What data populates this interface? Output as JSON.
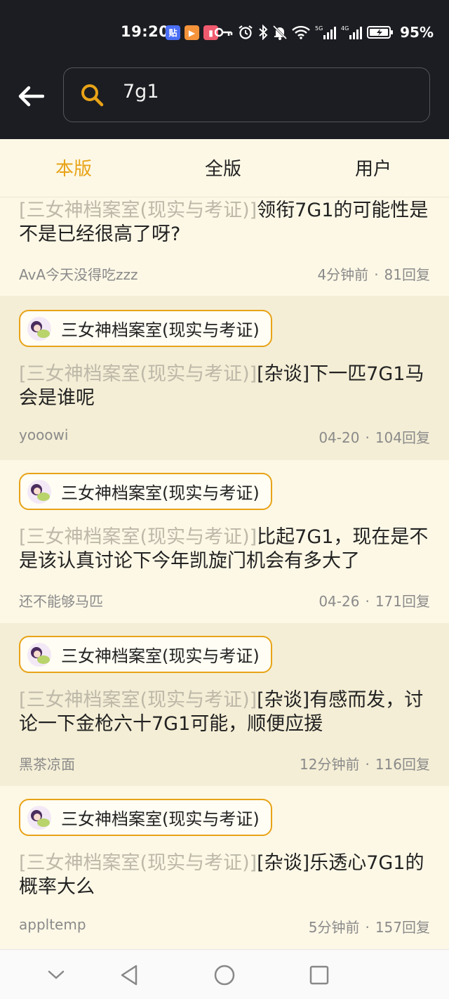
{
  "status_bar": {
    "time": "19:20",
    "apps": [
      {
        "icon": "tieba-app-icon",
        "label": "贴",
        "color": "#4a6ef5"
      },
      {
        "icon": "video-app-icon",
        "label": "▶",
        "color": "#f5933b"
      },
      {
        "icon": "book-app-icon",
        "label": "▮",
        "color": "#f05a6e"
      }
    ],
    "network": "5G",
    "network2": "4G",
    "battery": "95%"
  },
  "search": {
    "query": "7g1",
    "accent": "#e8a317"
  },
  "tabs": [
    {
      "label": "本版",
      "active": true
    },
    {
      "label": "全版",
      "active": false
    },
    {
      "label": "用户",
      "active": false
    }
  ],
  "posts": [
    {
      "forum": "",
      "prefix": "[三女神档案室(现实与考证)]",
      "title": "领衔7G1的可能性是不是已经很高了呀?",
      "author": "AvA今天没得吃zzz",
      "time": "4分钟前",
      "replies": "81回复"
    },
    {
      "forum": "三女神档案室(现实与考证)",
      "prefix": "[三女神档案室(现实与考证)]",
      "title": "[杂谈]下一匹7G1马会是谁呢",
      "author": "yooowi",
      "time": "04-20",
      "replies": "104回复"
    },
    {
      "forum": "三女神档案室(现实与考证)",
      "prefix": "[三女神档案室(现实与考证)]",
      "title": "比起7G1，现在是不是该认真讨论下今年凯旋门机会有多大了",
      "author": "还不能够马匹",
      "time": "04-26",
      "replies": "171回复"
    },
    {
      "forum": "三女神档案室(现实与考证)",
      "prefix": "[三女神档案室(现实与考证)]",
      "title": "[杂谈]有感而发，讨论一下金枪六十7G1可能，顺便应援",
      "author": "黑茶凉面",
      "time": "12分钟前",
      "replies": "116回复"
    },
    {
      "forum": "三女神档案室(现实与考证)",
      "prefix": "[三女神档案室(现实与考证)]",
      "title": "[杂谈]乐透心7G1的概率大么",
      "author": "appltemp",
      "time": "5分钟前",
      "replies": "157回复"
    }
  ],
  "meta_separator": "·",
  "nav": [
    "collapse-icon",
    "back-triangle-icon",
    "home-circle-icon",
    "recents-square-icon"
  ]
}
